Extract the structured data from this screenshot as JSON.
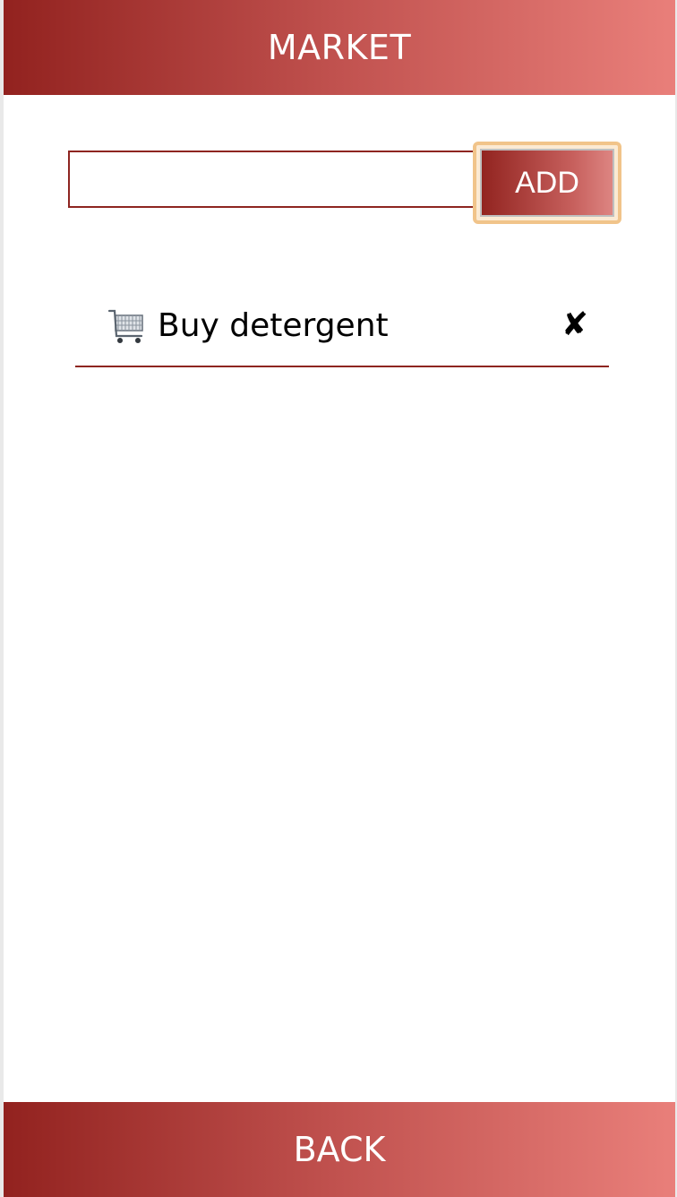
{
  "header": {
    "title": "MARKET"
  },
  "add_form": {
    "input_value": "",
    "input_placeholder": "",
    "button_label": "ADD"
  },
  "tasks": [
    {
      "icon": "shopping-cart-icon",
      "label": "Buy detergent",
      "delete_icon": "close-icon",
      "delete_glyph": "✘"
    }
  ],
  "footer": {
    "back_label": "BACK"
  },
  "colors": {
    "brand_dark": "#92221f",
    "brand_light": "#e97f7a",
    "focus_ring": "#f1c48a"
  }
}
